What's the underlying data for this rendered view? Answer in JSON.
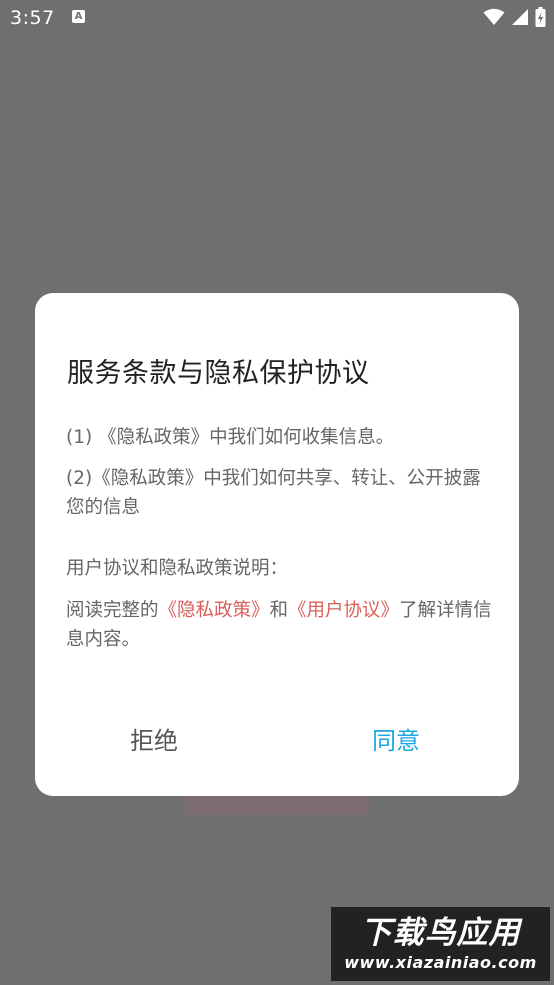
{
  "status_bar": {
    "time": "3:57",
    "notification_icon": "A",
    "icons": [
      "wifi-icon",
      "signal-icon",
      "battery-icon"
    ],
    "colors": {
      "foreground": "#ffffff"
    }
  },
  "dialog": {
    "title": "服务条款与隐私保护协议",
    "items": [
      "(1) 《隐私政策》中我们如何收集信息。",
      "(2)《隐私政策》中我们如何共享、转让、公开披露您的信息"
    ],
    "section_label": "用户协议和隐私政策说明：",
    "read_text": {
      "prefix": "阅读完整的",
      "privacy_link": "《隐私政策》",
      "middle": "和",
      "user_link": "《用户协议》",
      "suffix": "了解详情信息内容。"
    },
    "reject_label": "拒绝",
    "agree_label": "同意",
    "colors": {
      "link": "#d9605a",
      "agree": "#1ba8e3",
      "overlay": "#6f6f6f"
    }
  },
  "watermark": {
    "main": "下载鸟应用",
    "sub": "www.xiazainiao.com"
  }
}
